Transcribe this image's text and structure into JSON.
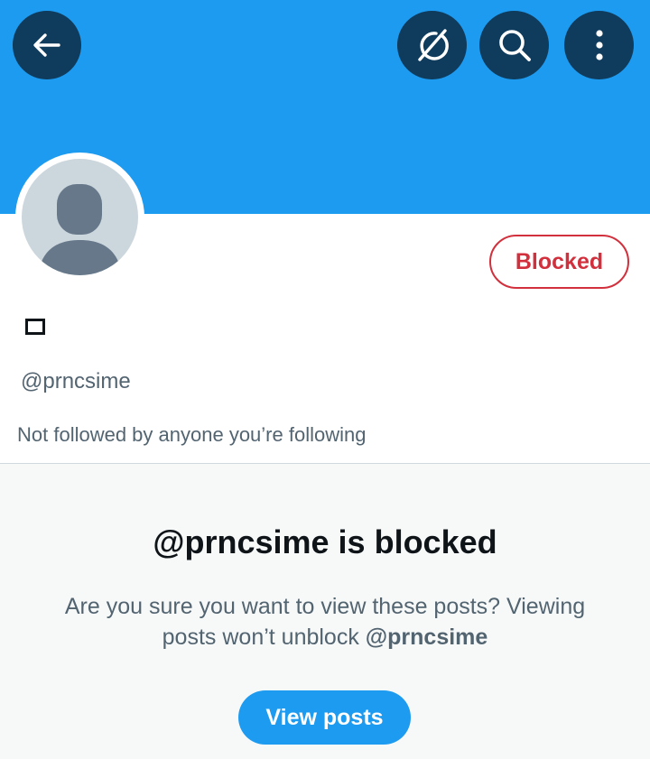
{
  "header": {
    "icons": {
      "back": "arrow-left-icon",
      "grok": "grok-icon",
      "search": "search-icon",
      "more": "more-vertical-icon"
    },
    "banner_color": "#1d9bf0",
    "button_color": "#0f3b5c"
  },
  "profile": {
    "display_name_glyph": "□",
    "handle": "@prncsime",
    "followers_note": "Not followed by anyone you’re following",
    "blocked_button_label": "Blocked",
    "blocked_color": "#d1303c"
  },
  "blocked_notice": {
    "title": "@prncsime is blocked",
    "description_prefix": "Are you sure you want to view these posts? Viewing posts won’t unblock ",
    "description_handle": "@prncsime",
    "view_posts_label": "View posts"
  }
}
